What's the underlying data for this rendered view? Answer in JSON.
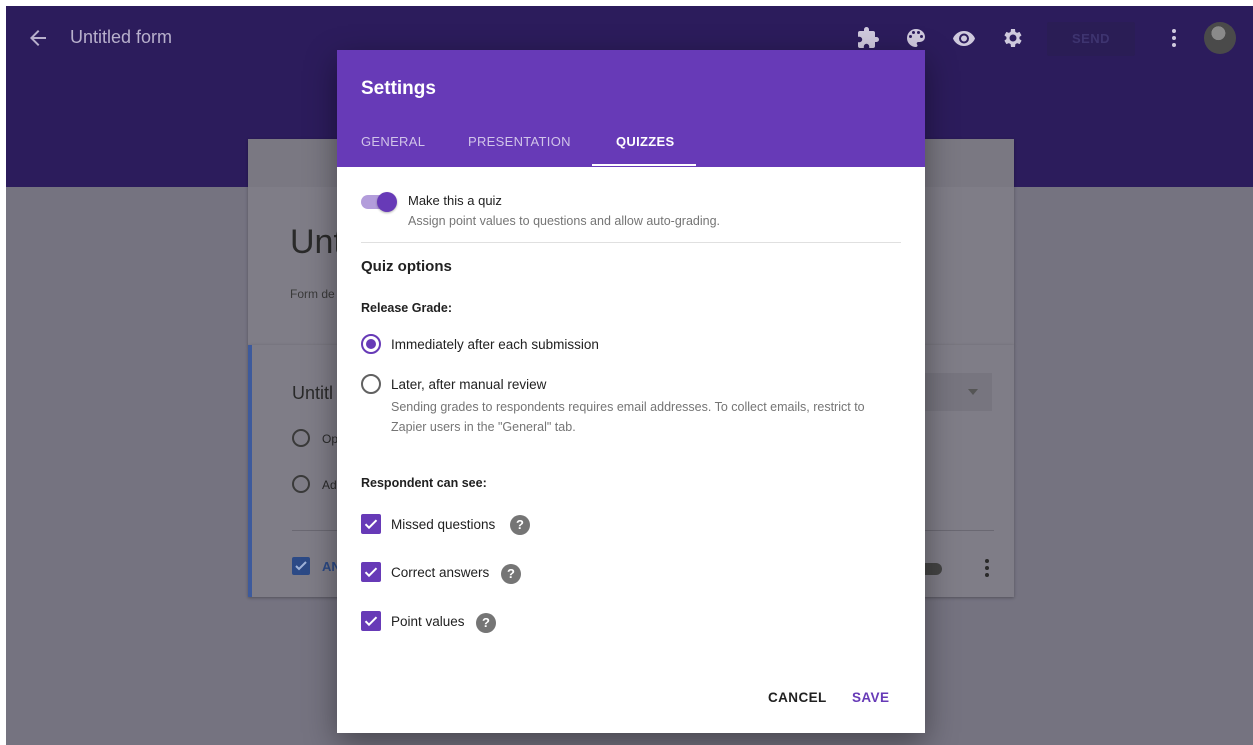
{
  "app": {
    "form_title": "Untitled form",
    "send_label": "SEND",
    "header_card": {
      "title": "Unt",
      "description": "Form de"
    },
    "question_card": {
      "title": "Untitl",
      "options": [
        "Op",
        "Ad"
      ],
      "answer_key_label": "AN"
    }
  },
  "dialog": {
    "title": "Settings",
    "tabs": [
      {
        "label": "GENERAL",
        "active": false
      },
      {
        "label": "PRESENTATION",
        "active": false
      },
      {
        "label": "QUIZZES",
        "active": true
      }
    ],
    "quiz_toggle": {
      "label": "Make this a quiz",
      "description": "Assign point values to questions and allow auto-grading.",
      "on": true
    },
    "quiz_options_title": "Quiz options",
    "release_grade": {
      "title": "Release Grade:",
      "options": [
        {
          "label": "Immediately after each submission",
          "selected": true
        },
        {
          "label": "Later, after manual review",
          "selected": false,
          "note": "Sending grades to respondents requires email addresses. To collect emails, restrict to Zapier users in the \"General\" tab."
        }
      ]
    },
    "respondent_can_see": {
      "title": "Respondent can see:",
      "items": [
        {
          "label": "Missed questions",
          "checked": true
        },
        {
          "label": "Correct answers",
          "checked": true
        },
        {
          "label": "Point values",
          "checked": true
        }
      ]
    },
    "actions": {
      "cancel": "CANCEL",
      "save": "SAVE"
    }
  },
  "colors": {
    "accent": "#673ab7",
    "accent_light": "#b39ddb",
    "overlay_header": "#2c1c5c",
    "overlay_body": "#757380"
  },
  "icons": [
    "back-arrow-icon",
    "puzzle-icon",
    "palette-icon",
    "eye-icon",
    "gear-icon",
    "more-vert-icon",
    "help-icon",
    "check-icon"
  ]
}
